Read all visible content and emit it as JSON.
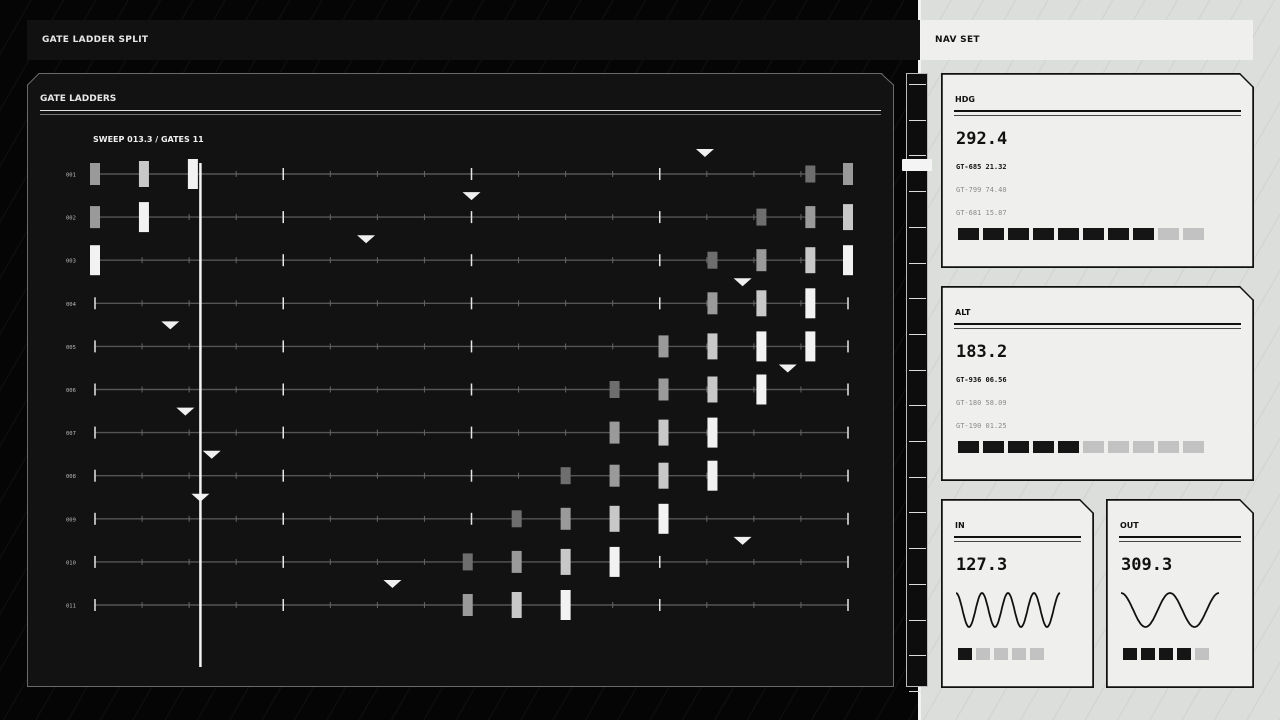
{
  "header": {
    "left_title": "GATE LADDER SPLIT",
    "right_title": "NAV SET"
  },
  "gate_panel": {
    "title": "GATE LADDERS",
    "sweep_label": "SWEEP 013.3 / GATES 11",
    "sweep_position": 0.14,
    "rows": [
      {
        "label": "001",
        "marker": 0.81,
        "gates": [
          {
            "x": 0.0,
            "tone": "mid"
          },
          {
            "x": 0.065,
            "tone": "light"
          },
          {
            "x": 0.13,
            "tone": "white"
          },
          {
            "x": 0.95,
            "tone": "dark"
          },
          {
            "x": 1.0,
            "tone": "mid"
          }
        ]
      },
      {
        "label": "002",
        "marker": 0.5,
        "gates": [
          {
            "x": 0.0,
            "tone": "mid"
          },
          {
            "x": 0.065,
            "tone": "white"
          },
          {
            "x": 0.885,
            "tone": "dark"
          },
          {
            "x": 0.95,
            "tone": "mid"
          },
          {
            "x": 1.0,
            "tone": "light"
          }
        ]
      },
      {
        "label": "003",
        "marker": 0.36,
        "gates": [
          {
            "x": 0.0,
            "tone": "white"
          },
          {
            "x": 0.82,
            "tone": "dark"
          },
          {
            "x": 0.885,
            "tone": "mid"
          },
          {
            "x": 0.95,
            "tone": "light"
          },
          {
            "x": 1.0,
            "tone": "white"
          }
        ]
      },
      {
        "label": "004",
        "marker": 0.86,
        "gates": [
          {
            "x": 0.82,
            "tone": "mid"
          },
          {
            "x": 0.885,
            "tone": "light"
          },
          {
            "x": 0.95,
            "tone": "white"
          }
        ]
      },
      {
        "label": "005",
        "marker": 0.1,
        "gates": [
          {
            "x": 0.755,
            "tone": "mid"
          },
          {
            "x": 0.82,
            "tone": "light"
          },
          {
            "x": 0.885,
            "tone": "white"
          },
          {
            "x": 0.95,
            "tone": "white"
          }
        ]
      },
      {
        "label": "006",
        "marker": 0.92,
        "gates": [
          {
            "x": 0.69,
            "tone": "dark"
          },
          {
            "x": 0.755,
            "tone": "mid"
          },
          {
            "x": 0.82,
            "tone": "light"
          },
          {
            "x": 0.885,
            "tone": "white"
          }
        ]
      },
      {
        "label": "007",
        "marker": 0.12,
        "gates": [
          {
            "x": 0.69,
            "tone": "mid"
          },
          {
            "x": 0.755,
            "tone": "light"
          },
          {
            "x": 0.82,
            "tone": "white"
          }
        ]
      },
      {
        "label": "008",
        "marker": 0.155,
        "gates": [
          {
            "x": 0.625,
            "tone": "dark"
          },
          {
            "x": 0.69,
            "tone": "mid"
          },
          {
            "x": 0.755,
            "tone": "light"
          },
          {
            "x": 0.82,
            "tone": "white"
          }
        ]
      },
      {
        "label": "009",
        "marker": 0.14,
        "gates": [
          {
            "x": 0.56,
            "tone": "dark"
          },
          {
            "x": 0.625,
            "tone": "mid"
          },
          {
            "x": 0.69,
            "tone": "light"
          },
          {
            "x": 0.755,
            "tone": "white"
          }
        ]
      },
      {
        "label": "010",
        "marker": 0.86,
        "gates": [
          {
            "x": 0.495,
            "tone": "dark"
          },
          {
            "x": 0.56,
            "tone": "mid"
          },
          {
            "x": 0.625,
            "tone": "light"
          },
          {
            "x": 0.69,
            "tone": "white"
          }
        ]
      },
      {
        "label": "011",
        "marker": 0.395,
        "gates": [
          {
            "x": 0.495,
            "tone": "mid"
          },
          {
            "x": 0.56,
            "tone": "light"
          },
          {
            "x": 0.625,
            "tone": "white"
          }
        ]
      }
    ]
  },
  "scrollbar": {
    "position": 0.14
  },
  "cards": {
    "hdg": {
      "title": "HDG",
      "value": "292.4",
      "lines": [
        "GT-685 21.32",
        "GT-799 74.40",
        "GT-681 15.87"
      ],
      "segments_on": 8,
      "segments_total": 10
    },
    "alt": {
      "title": "ALT",
      "value": "183.2",
      "lines": [
        "GT-936 06.56",
        "GT-180 58.09",
        "GT-190 01.25"
      ],
      "segments_on": 5,
      "segments_total": 10
    },
    "in": {
      "title": "IN",
      "value": "127.3",
      "segments_on": 1,
      "segments_total": 5
    },
    "out": {
      "title": "OUT",
      "value": "309.3",
      "segments_on": 4,
      "segments_total": 5
    }
  },
  "colors": {
    "gate_white": "#f2f2f2",
    "gate_light": "#c8c8c8",
    "gate_mid": "#9a9a9a",
    "gate_dark": "#6e6e6e",
    "ink": "#111111",
    "paper": "#eff0ee"
  }
}
